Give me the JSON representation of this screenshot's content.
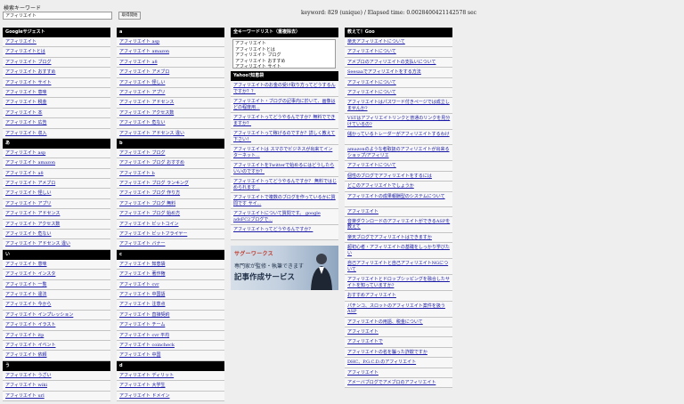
{
  "top": {
    "label": "検索キーワード",
    "search_value": "アフィリエイト",
    "button_label": "取得開始",
    "status": "keyword: 829 (unique) / Elapsed time: 0.0028400421142578 sec"
  },
  "col1": [
    {
      "header": "Googleサジェスト",
      "items": [
        "アフィリエイト",
        "アフィリエイトとは",
        "アフィリエイト ブログ",
        "アフィリエイト おすすめ",
        "アフィリエイト サイト",
        "アフィリエイト 意味",
        "アフィリエイト 税金",
        "アフィリエイト 本",
        "アフィリエイト 広告",
        "アフィリエイト 収入"
      ]
    },
    {
      "header": "あ",
      "items": [
        "アフィリエイト asp",
        "アフィリエイト amazon",
        "アフィリエイト a8",
        "アフィリエイト アメブロ",
        "アフィリエイト 怪しい",
        "アフィリエイト アプリ",
        "アフィリエイト アドセンス",
        "アフィリエイト アクセス数",
        "アフィリエイト 危ない",
        "アフィリエイト アドセンス 違い"
      ]
    },
    {
      "header": "い",
      "items": [
        "アフィリエイト 意味",
        "アフィリエイト インスタ",
        "アフィリエイト 一覧",
        "アフィリエイト 違法",
        "アフィリエイト 今から",
        "アフィリエイト インプレッション",
        "アフィリエイト イラスト",
        "アフィリエイト itp",
        "アフィリエイト イベント",
        "アフィリエイト 依頼"
      ]
    },
    {
      "header": "う",
      "items": [
        "アフィリエイト うざい",
        "アフィリエイト wiki",
        "アフィリエイト url"
      ]
    }
  ],
  "col2": [
    {
      "header": "a",
      "items": [
        "アフィリエイト asp",
        "アフィリエイト amazon",
        "アフィリエイト a8",
        "アフィリエイト アメブロ",
        "アフィリエイト 怪しい",
        "アフィリエイト アプリ",
        "アフィリエイト アドセンス",
        "アフィリエイト アクセス数",
        "アフィリエイト 危ない",
        "アフィリエイト アドセンス 違い"
      ]
    },
    {
      "header": "b",
      "items": [
        "アフィリエイト ブログ",
        "アフィリエイト ブログ おすすめ",
        "アフィリエイト b",
        "アフィリエイト ブログ ランキング",
        "アフィリエイト ブログ 作り方",
        "アフィリエイト ブログ 無料",
        "アフィリエイト ブログ 始め方",
        "アフィリエイト ビットコイン",
        "アフィリエイト ビットフライヤー",
        "アフィリエイト バナー"
      ]
    },
    {
      "header": "c",
      "items": [
        "アフィリエイト 知恵袋",
        "アフィリエイト 著作権",
        "アフィリエイト cvr",
        "アフィリエイト 中国語",
        "アフィリエイト 注意点",
        "アフィリエイト 直接契約",
        "アフィリエイト チーム",
        "アフィリエイト cvr 平均",
        "アフィリエイト coincheck",
        "アフィリエイト 中国"
      ]
    },
    {
      "header": "d",
      "items": [
        "アフィリエイト ディリット",
        "アフィリエイト 大学生",
        "アフィリエイト ドメイン"
      ]
    }
  ],
  "col3": {
    "kw_header": "全キーワードリスト（重複除去）",
    "kw_text": "アフィリエイト\nアフィリエイトとは\nアフィリエイト ブログ\nアフィリエイト おすすめ\nアフィリエイト サイト",
    "qa_header": "Yahoo!知恵袋",
    "qa_items": [
      "アフィリエイトのお金の受け取り方ってどうするんですか？？",
      "アフィリエイト・ブログの記事内に於いて、画像はどの程度用...",
      "アフィリエイトってどうやるんですか？無料でできますか？",
      "アフィリエイトって稼げるのですか？詳しく教えて下さい！",
      "アフィリエイトは スマホでビジネスが出来てインターネット...",
      "アフィリエイトをTwitterで始めるにはどうしたらいいのですか？",
      "アフィリエイトってどうやるんですか？ 無料ではじめられます...",
      "アフィリエイトで複数のブログを作っているかに質問です サイ...",
      "アフィリエイトについて質問です。 google adsFC2ブログで...",
      "アフィリエイトってどうやるんですか？"
    ],
    "ad": {
      "logo": "サグーワークス",
      "line1": "専門家が監修・執筆できます",
      "line2": "記事作成サービス"
    }
  },
  "col4": {
    "header": "教えて！Goo",
    "items": [
      "楽天アフィリエイトについて",
      "アフィリエイトについて",
      "アメブロのアフィリエイトの支払いについて",
      "Seesaaでアフィリエイトをする方法",
      "アフィリエイトについて",
      "アフィリエイトについて",
      "アフィリエイトはパスワード付きページでは成立しませんか?",
      "VSTはアフィリエイトリンクと普通のリンクを見分けているの?",
      "儲かっているトレーダーがアフィリエイトするわけ",
      "amazonのような者取扱のアフィリエイトが出来るショップ/アフィリエ",
      "アフィリエイトについて",
      "個性のブログでアフィリエイトをするには",
      "どこのアフィリエイトでしょうか",
      "アフィリエイトの成果報酬型のシステムについて",
      "アフィリエイト",
      "音楽ダウンロードのアフィリエイトができるASPを教えて",
      "楽天ブログでアフィリエイトはできますか",
      "超初心者・アフィリエイトの基礎をしっかり学びたい",
      "自己アフィリエイトと自己アフィリエイトNGについて",
      "アフィリエイトとドロップシッピングを融合したサイトを知っていますか?",
      "おすすめアフィリエイト",
      "パチンコ、スロットのアフィリエイト案件を扱うASP",
      "アフィリエイトの用語、税金について",
      "アフィリエイト",
      "アフィリエイトで",
      "アフィリエイトの名を騙った詐欺ですか",
      "DHC、P.G.C.D.のアフィリエイト",
      "アフィリエイト",
      "アメーバブログでアメブロのアフィリエイト"
    ],
    "two_line_flags": [
      0,
      0,
      0,
      0,
      0,
      0,
      1,
      1,
      1,
      1,
      0,
      0,
      0,
      1,
      0,
      1,
      0,
      1,
      1,
      1,
      0,
      1,
      0,
      0,
      0,
      0,
      0,
      0,
      0
    ]
  },
  "colors": {
    "link": "#1a1aa6",
    "header_bg": "#000000",
    "page_bg": "#eeeeee",
    "row_bg": "#f7f7f7"
  }
}
